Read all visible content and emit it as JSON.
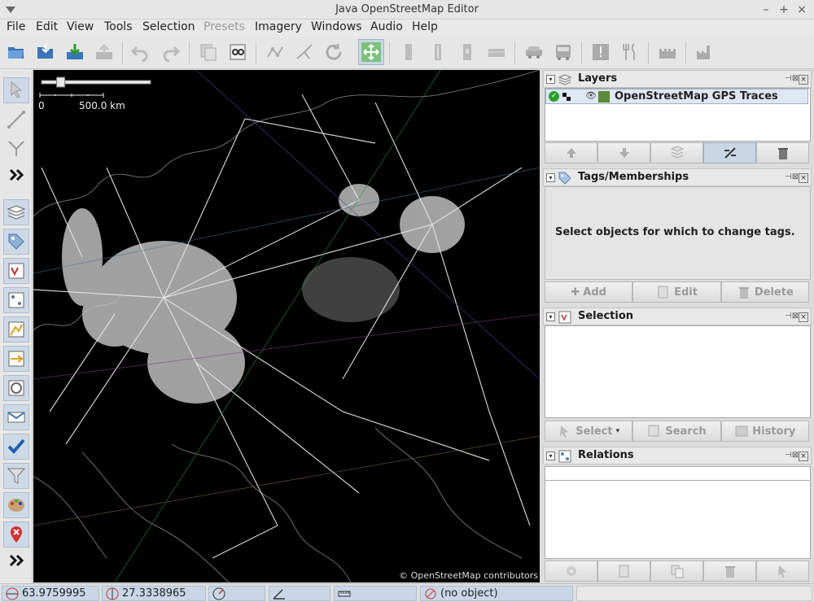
{
  "window": {
    "title": "Java OpenStreetMap Editor"
  },
  "menubar": {
    "items": [
      {
        "label": "File",
        "enabled": true
      },
      {
        "label": "Edit",
        "enabled": true
      },
      {
        "label": "View",
        "enabled": true
      },
      {
        "label": "Tools",
        "enabled": true
      },
      {
        "label": "Selection",
        "enabled": true
      },
      {
        "label": "Presets",
        "enabled": false
      },
      {
        "label": "Imagery",
        "enabled": true
      },
      {
        "label": "Windows",
        "enabled": true
      },
      {
        "label": "Audio",
        "enabled": true
      },
      {
        "label": "Help",
        "enabled": true
      }
    ]
  },
  "toolbar": {
    "buttons": [
      "open-file-icon",
      "open-location-icon",
      "download-icon",
      "upload-icon",
      "undo-icon",
      "redo-icon",
      "copy-icon",
      "preferences-icon",
      "simplify-icon",
      "split-icon",
      "refresh-icon",
      "move-icon",
      "preset-1-icon",
      "preset-2-icon",
      "preset-3-icon",
      "preset-4-icon",
      "car-icon",
      "bus-icon",
      "warning-icon",
      "restaurant-icon",
      "castle-icon",
      "factory-icon"
    ]
  },
  "left_toolbar": {
    "tools": [
      "select-mode",
      "draw-mode",
      "improve-way-mode",
      "more-modes",
      "layers-toggle",
      "tags-toggle",
      "selection-toggle",
      "relations-toggle",
      "validation-toggle",
      "conflict-toggle",
      "filter-toggle",
      "notes-toggle",
      "check-toggle",
      "filter-funnel-toggle",
      "map-paint-toggle",
      "location-toggle",
      "more-toggles"
    ]
  },
  "map": {
    "scale_zero": "0",
    "scale_label": "500.0 km",
    "attribution": "© OpenStreetMap contributors",
    "zoom_level_fraction": 0.15
  },
  "panels": {
    "layers": {
      "title": "Layers",
      "rows": [
        {
          "name": "OpenStreetMap GPS Traces",
          "visible": true,
          "active": true
        }
      ]
    },
    "tags": {
      "title": "Tags/Memberships",
      "empty_message": "Select objects for which to change tags.",
      "buttons": {
        "add": "Add",
        "edit": "Edit",
        "delete": "Delete"
      }
    },
    "selection": {
      "title": "Selection",
      "buttons": {
        "select": "Select",
        "search": "Search",
        "history": "History"
      }
    },
    "relations": {
      "title": "Relations",
      "filter_value": ""
    }
  },
  "statusbar": {
    "lat": "63.9759995",
    "lon": "27.3338965",
    "heading": "",
    "angle": "",
    "distance": "",
    "object": "(no object)"
  },
  "colors": {
    "selected_bg": "#c8d6e6",
    "map_bg": "#000000",
    "trace": "#e8e8e8"
  }
}
